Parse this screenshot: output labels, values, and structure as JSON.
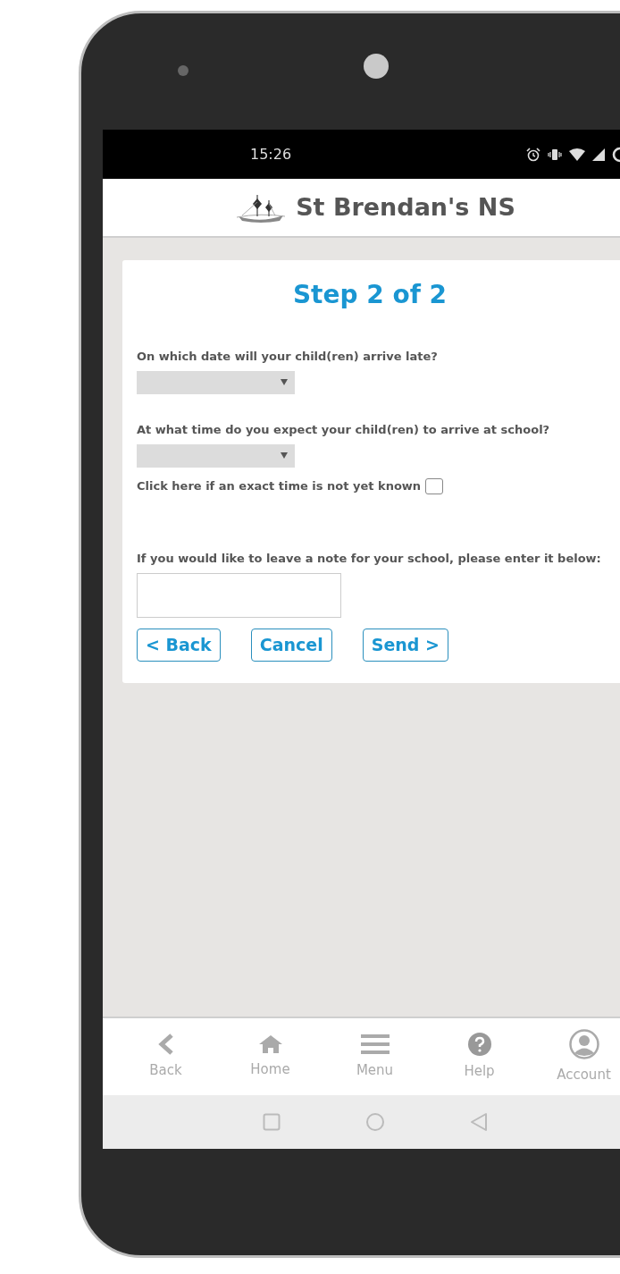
{
  "status_bar": {
    "time": "15:26"
  },
  "header": {
    "title": "St Brendan's NS"
  },
  "form": {
    "heading": "Step 2 of 2",
    "fields": [
      {
        "kind": "select",
        "label": "On which date will your child(ren) arrive late?"
      },
      {
        "kind": "select",
        "label": "At what time do you expect your child(ren) to arrive at school?",
        "checkbox": {
          "label": "Click here if an exact time is not yet known",
          "checked": false
        }
      },
      {
        "kind": "textarea",
        "label": "If you would like to leave a note for your school, please enter it below:"
      }
    ],
    "buttons": [
      "< Back",
      "Cancel",
      "Send >"
    ]
  },
  "bottom_nav": [
    {
      "label": "Back"
    },
    {
      "label": "Home"
    },
    {
      "label": "Menu"
    },
    {
      "label": "Help"
    },
    {
      "label": "Account"
    }
  ]
}
